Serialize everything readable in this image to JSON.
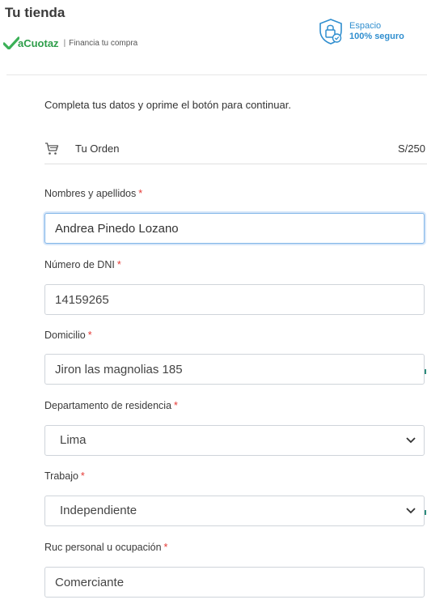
{
  "header": {
    "store_title": "Tu tienda",
    "brand_name": "aCuotaz",
    "brand_separator": "|",
    "brand_tagline": "Financia tu compra",
    "secure_line1": "Espacio",
    "secure_line2": "100% seguro"
  },
  "intro": "Completa tus datos y oprime el botón para continuar.",
  "order": {
    "label": "Tu Orden",
    "amount": "S/250"
  },
  "required_mark": "*",
  "form": {
    "name": {
      "label": "Nombres y apellidos",
      "value": "Andrea Pinedo Lozano"
    },
    "dni": {
      "label": "Número de DNI",
      "value": "14159265"
    },
    "address": {
      "label": "Domicilio",
      "value": "Jiron las magnolias 185"
    },
    "department": {
      "label": "Departamento de residencia",
      "value": "Lima"
    },
    "job": {
      "label": "Trabajo",
      "value": "Independiente"
    },
    "ruc": {
      "label": "Ruc personal u ocupación",
      "value": "Comerciante"
    }
  },
  "colors": {
    "brand_green": "#2e9e4a",
    "secure_blue": "#2f8ecf",
    "required_red": "#e53935",
    "focus_border": "#7fb5e8"
  },
  "icons": [
    "checkmark-logo-icon",
    "shield-lock-icon",
    "cart-icon",
    "chevron-down-icon"
  ]
}
